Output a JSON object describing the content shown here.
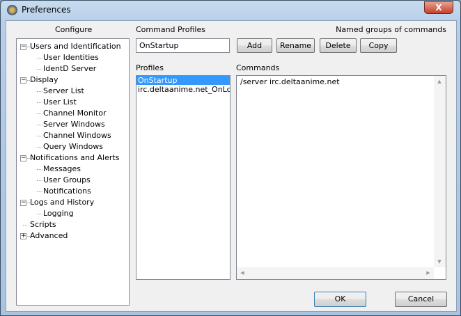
{
  "window": {
    "title": "Preferences",
    "close": "X"
  },
  "configure": {
    "label": "Configure",
    "tree": [
      {
        "label": "Users and Identification",
        "level": 0,
        "expander": "-"
      },
      {
        "label": "User Identities",
        "level": 1
      },
      {
        "label": "IdentD Server",
        "level": 1
      },
      {
        "label": "Display",
        "level": 0,
        "expander": "-"
      },
      {
        "label": "Server List",
        "level": 1
      },
      {
        "label": "User List",
        "level": 1
      },
      {
        "label": "Channel Monitor",
        "level": 1
      },
      {
        "label": "Server Windows",
        "level": 1
      },
      {
        "label": "Channel Windows",
        "level": 1
      },
      {
        "label": "Query Windows",
        "level": 1
      },
      {
        "label": "Notifications and Alerts",
        "level": 0,
        "expander": "-"
      },
      {
        "label": "Messages",
        "level": 1
      },
      {
        "label": "User Groups",
        "level": 1
      },
      {
        "label": "Notifications",
        "level": 1
      },
      {
        "label": "Logs and History",
        "level": 0,
        "expander": "-"
      },
      {
        "label": "Logging",
        "level": 1
      },
      {
        "label": "Scripts",
        "level": 0
      },
      {
        "label": "Advanced",
        "level": 0,
        "expander": "+"
      }
    ]
  },
  "profiles_section": {
    "label": "Command Profiles",
    "description": "Named groups of commands",
    "name_value": "OnStartup",
    "buttons": {
      "add": "Add",
      "rename": "Rename",
      "delete": "Delete",
      "copy": "Copy"
    },
    "profiles_label": "Profiles",
    "profiles": [
      "OnStartup",
      "irc.deltaanime.net_OnLogg"
    ],
    "selected": 0,
    "commands_label": "Commands",
    "commands_value": "/server irc.deltaanime.net"
  },
  "footer": {
    "ok": "OK",
    "cancel": "Cancel"
  }
}
